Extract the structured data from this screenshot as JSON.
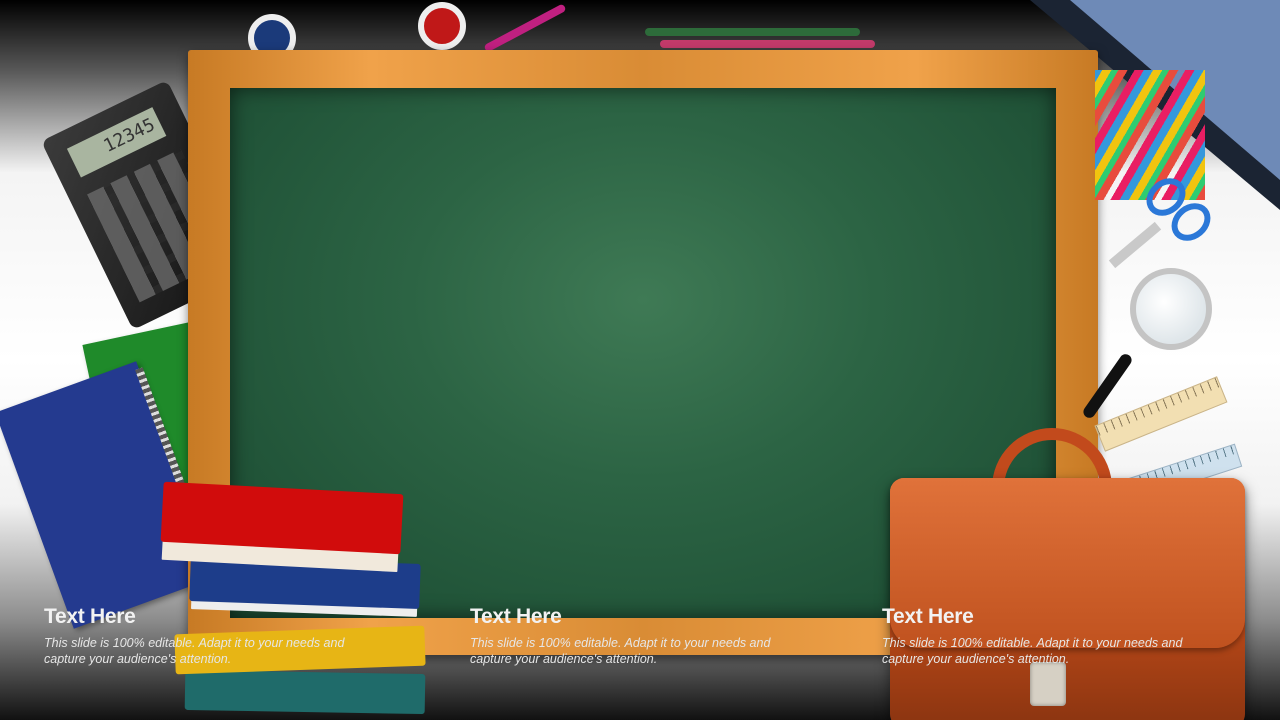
{
  "calculator": {
    "display": "12345"
  },
  "text_blocks": [
    {
      "title": "Text Here",
      "body": "This slide is 100% editable. Adapt it to your needs and capture your audience's attention."
    },
    {
      "title": "Text Here",
      "body": "This slide is 100% editable. Adapt it to your needs and capture your audience's attention."
    },
    {
      "title": "Text Here",
      "body": "This slide is 100% editable. Adapt it to your needs and capture your audience's attention."
    }
  ],
  "colors": {
    "board": "#2c6444",
    "frame": "#e0943e",
    "briefcase": "#c0521f",
    "corner_accent": "#7d9ccf"
  },
  "icons": [
    "calculator-icon",
    "notebook-icon",
    "books-icon",
    "scissors-icon",
    "magnifier-icon",
    "ruler-icon",
    "briefcase-icon",
    "pencils-icon"
  ]
}
